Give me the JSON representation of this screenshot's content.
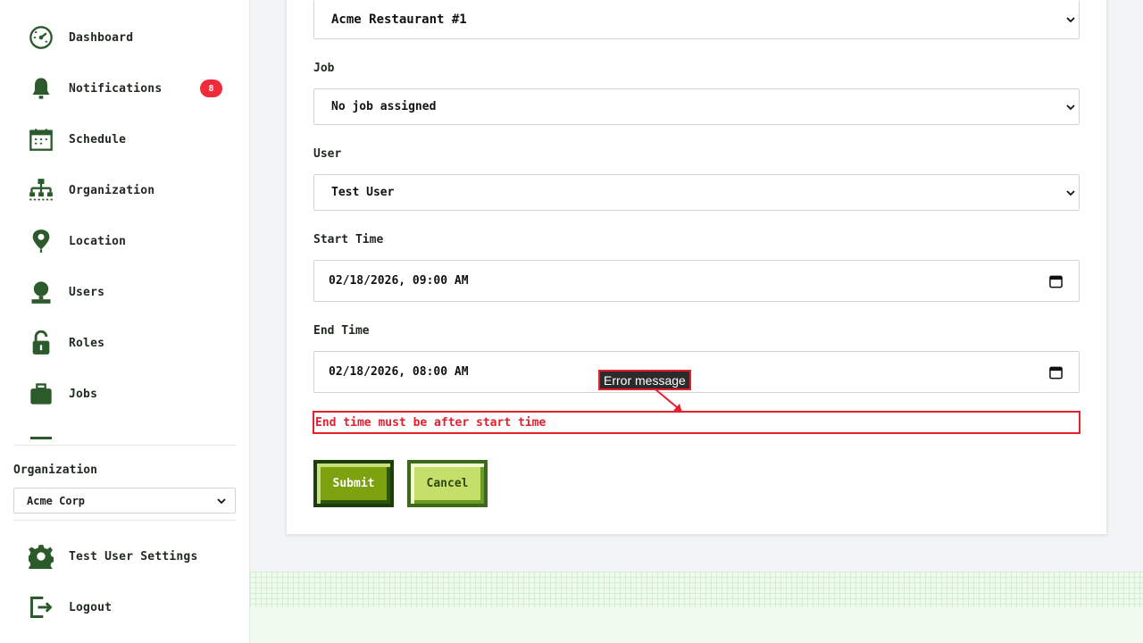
{
  "sidebar": {
    "items": [
      {
        "label": "Dashboard",
        "icon": "dashboard-icon"
      },
      {
        "label": "Notifications",
        "icon": "bell-icon",
        "badge": "8"
      },
      {
        "label": "Schedule",
        "icon": "calendar-icon"
      },
      {
        "label": "Organization",
        "icon": "org-chart-icon"
      },
      {
        "label": "Location",
        "icon": "location-pin-icon"
      },
      {
        "label": "Users",
        "icon": "user-icon"
      },
      {
        "label": "Roles",
        "icon": "lock-icon"
      },
      {
        "label": "Jobs",
        "icon": "briefcase-icon"
      }
    ],
    "organization_label": "Organization",
    "organization_value": "Acme Corp",
    "settings_label": "Test User Settings",
    "logout_label": "Logout"
  },
  "form": {
    "location_value": "Acme Restaurant #1",
    "job_label": "Job",
    "job_value": "No job assigned",
    "user_label": "User",
    "user_value": "Test User",
    "start_label": "Start Time",
    "start_value": "02/18/2026, 09:00 AM",
    "end_label": "End Time",
    "end_value": "02/18/2026, 08:00 AM",
    "error_text": "End time must be after start time",
    "submit_label": "Submit",
    "cancel_label": "Cancel"
  },
  "annotation": {
    "tooltip": "Error message"
  },
  "colors": {
    "error": "#e4202f",
    "brand_green": "#7da10f",
    "badge": "#ef2b3a"
  }
}
